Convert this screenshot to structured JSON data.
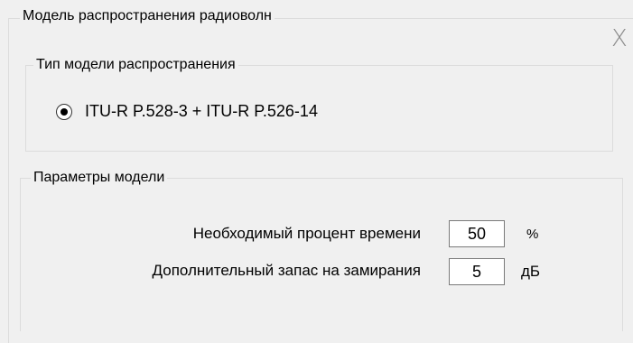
{
  "outer_group": {
    "title": "Модель распространения радиоволн"
  },
  "close_label": "X",
  "model_type_group": {
    "title": "Тип модели распространения",
    "option_label": "ITU-R P.528-3 + ITU-R P.526-14",
    "option_selected": true
  },
  "params_group": {
    "title": "Параметры модели",
    "time_percent": {
      "label": "Необходимый процент времени",
      "value": "50",
      "unit": "%"
    },
    "fade_margin": {
      "label": "Дополнительный запас на замирания",
      "value": "5",
      "unit": "дБ"
    }
  }
}
